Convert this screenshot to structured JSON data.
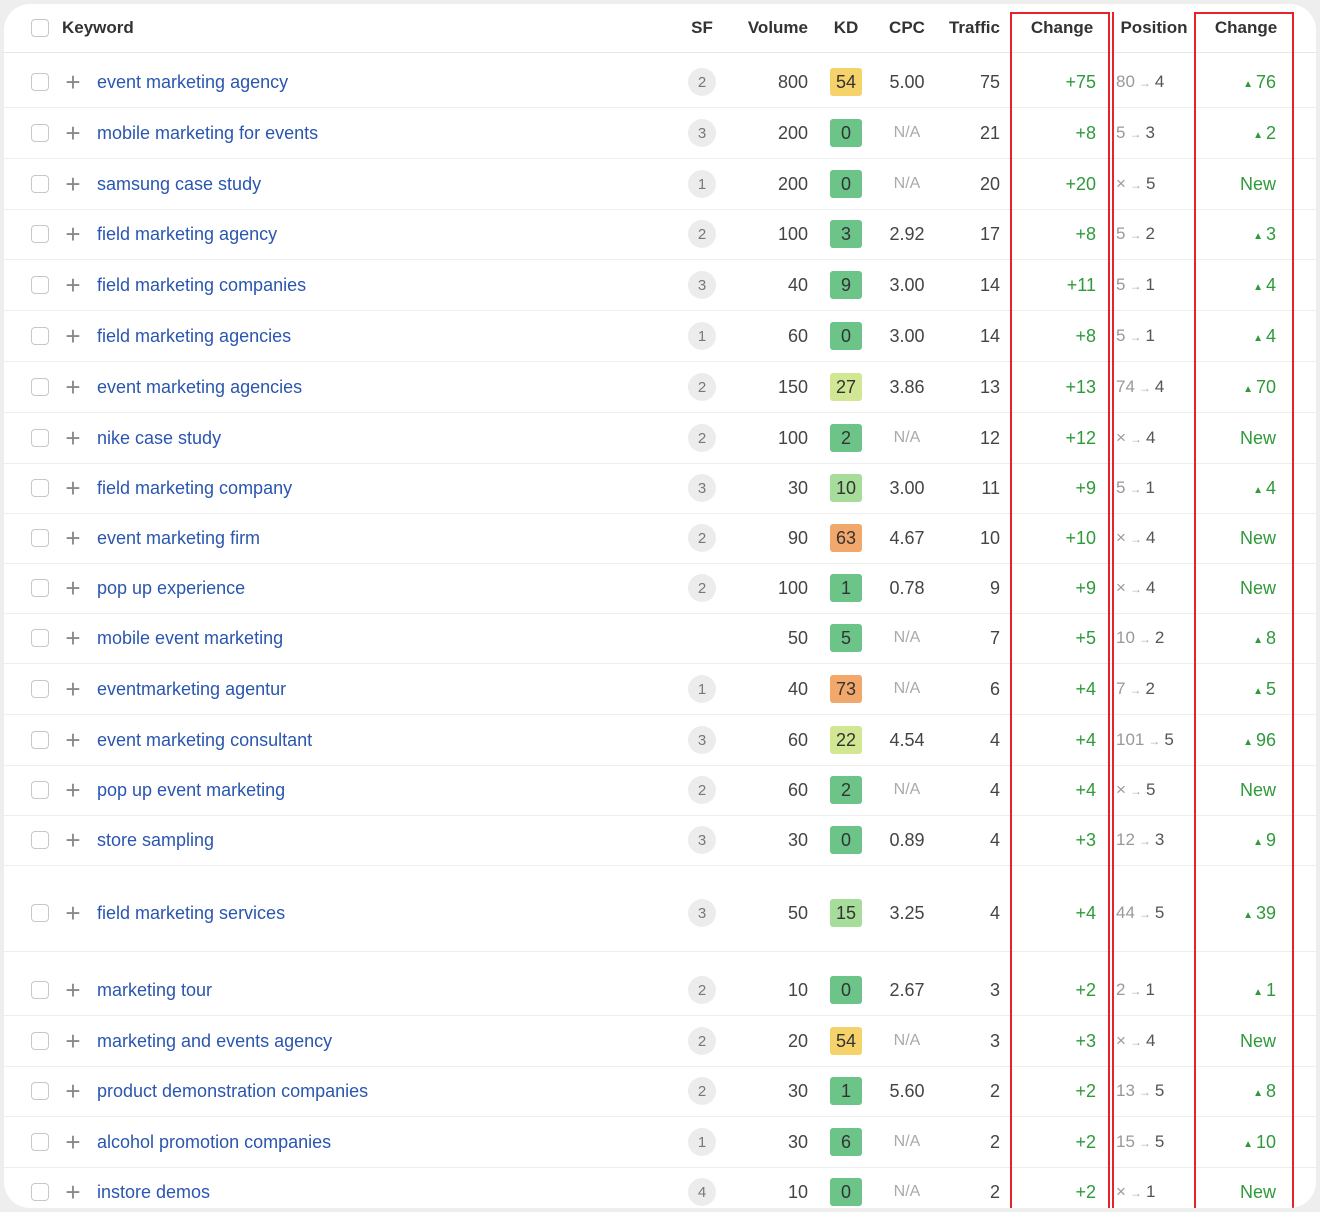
{
  "header": {
    "keyword": "Keyword",
    "sf": "SF",
    "volume": "Volume",
    "kd": "KD",
    "cpc": "CPC",
    "traffic": "Traffic",
    "traffic_change": "Change",
    "position": "Position",
    "position_change": "Change"
  },
  "colors": {
    "kd_green_dark": "#6cc488",
    "kd_green_light": "#a6dd9a",
    "kd_lime": "#d2e793",
    "kd_yellow": "#f6d36a",
    "kd_orange": "#f2a86a",
    "highlight_red": "#e8222a",
    "positive_green": "#2e9a3a",
    "keyword_blue": "#2a56b0"
  },
  "icons": {
    "add": "plus-icon",
    "checkbox": "checkbox-icon",
    "up": "triangle-up-icon",
    "arrow": "arrow-right-icon"
  },
  "arrow_glyph": "→",
  "up_glyph": "▲",
  "rows": [
    {
      "keyword": "event marketing agency",
      "sf": "2",
      "volume": "800",
      "kd": "54",
      "kd_color": "#f6d36a",
      "cpc": "5.00",
      "traffic": "75",
      "change": "+75",
      "pos_from": "80",
      "pos_to": "4",
      "pos_change": "76",
      "is_new": false
    },
    {
      "keyword": "mobile marketing for events",
      "sf": "3",
      "volume": "200",
      "kd": "0",
      "kd_color": "#6cc488",
      "cpc": "N/A",
      "traffic": "21",
      "change": "+8",
      "pos_from": "5",
      "pos_to": "3",
      "pos_change": "2",
      "is_new": false
    },
    {
      "keyword": "samsung case study",
      "sf": "1",
      "volume": "200",
      "kd": "0",
      "kd_color": "#6cc488",
      "cpc": "N/A",
      "traffic": "20",
      "change": "+20",
      "pos_from": "×",
      "pos_to": "5",
      "pos_change": "New",
      "is_new": true
    },
    {
      "keyword": "field marketing agency",
      "sf": "2",
      "volume": "100",
      "kd": "3",
      "kd_color": "#6cc488",
      "cpc": "2.92",
      "traffic": "17",
      "change": "+8",
      "pos_from": "5",
      "pos_to": "2",
      "pos_change": "3",
      "is_new": false
    },
    {
      "keyword": "field marketing companies",
      "sf": "3",
      "volume": "40",
      "kd": "9",
      "kd_color": "#6cc488",
      "cpc": "3.00",
      "traffic": "14",
      "change": "+11",
      "pos_from": "5",
      "pos_to": "1",
      "pos_change": "4",
      "is_new": false
    },
    {
      "keyword": "field marketing agencies",
      "sf": "1",
      "volume": "60",
      "kd": "0",
      "kd_color": "#6cc488",
      "cpc": "3.00",
      "traffic": "14",
      "change": "+8",
      "pos_from": "5",
      "pos_to": "1",
      "pos_change": "4",
      "is_new": false
    },
    {
      "keyword": "event marketing agencies",
      "sf": "2",
      "volume": "150",
      "kd": "27",
      "kd_color": "#d2e793",
      "cpc": "3.86",
      "traffic": "13",
      "change": "+13",
      "pos_from": "74",
      "pos_to": "4",
      "pos_change": "70",
      "is_new": false
    },
    {
      "keyword": "nike case study",
      "sf": "2",
      "volume": "100",
      "kd": "2",
      "kd_color": "#6cc488",
      "cpc": "N/A",
      "traffic": "12",
      "change": "+12",
      "pos_from": "×",
      "pos_to": "4",
      "pos_change": "New",
      "is_new": true
    },
    {
      "keyword": "field marketing company",
      "sf": "3",
      "volume": "30",
      "kd": "10",
      "kd_color": "#a6dd9a",
      "cpc": "3.00",
      "traffic": "11",
      "change": "+9",
      "pos_from": "5",
      "pos_to": "1",
      "pos_change": "4",
      "is_new": false
    },
    {
      "keyword": "event marketing firm",
      "sf": "2",
      "volume": "90",
      "kd": "63",
      "kd_color": "#f2a86a",
      "cpc": "4.67",
      "traffic": "10",
      "change": "+10",
      "pos_from": "×",
      "pos_to": "4",
      "pos_change": "New",
      "is_new": true
    },
    {
      "keyword": "pop up experience",
      "sf": "2",
      "volume": "100",
      "kd": "1",
      "kd_color": "#6cc488",
      "cpc": "0.78",
      "traffic": "9",
      "change": "+9",
      "pos_from": "×",
      "pos_to": "4",
      "pos_change": "New",
      "is_new": true
    },
    {
      "keyword": "mobile event marketing",
      "sf": "",
      "volume": "50",
      "kd": "5",
      "kd_color": "#6cc488",
      "cpc": "N/A",
      "traffic": "7",
      "change": "+5",
      "pos_from": "10",
      "pos_to": "2",
      "pos_change": "8",
      "is_new": false
    },
    {
      "keyword": "eventmarketing agentur",
      "sf": "1",
      "volume": "40",
      "kd": "73",
      "kd_color": "#f2a86a",
      "cpc": "N/A",
      "traffic": "6",
      "change": "+4",
      "pos_from": "7",
      "pos_to": "2",
      "pos_change": "5",
      "is_new": false
    },
    {
      "keyword": "event marketing consultant",
      "sf": "3",
      "volume": "60",
      "kd": "22",
      "kd_color": "#d2e793",
      "cpc": "4.54",
      "traffic": "4",
      "change": "+4",
      "pos_from": "101",
      "pos_to": "5",
      "pos_change": "96",
      "is_new": false
    },
    {
      "keyword": "pop up event marketing",
      "sf": "2",
      "volume": "60",
      "kd": "2",
      "kd_color": "#6cc488",
      "cpc": "N/A",
      "traffic": "4",
      "change": "+4",
      "pos_from": "×",
      "pos_to": "5",
      "pos_change": "New",
      "is_new": true
    },
    {
      "keyword": "store sampling",
      "sf": "3",
      "volume": "30",
      "kd": "0",
      "kd_color": "#6cc488",
      "cpc": "0.89",
      "traffic": "4",
      "change": "+3",
      "pos_from": "12",
      "pos_to": "3",
      "pos_change": "9",
      "is_new": false
    },
    {
      "keyword": "field marketing services",
      "sf": "3",
      "volume": "50",
      "kd": "15",
      "kd_color": "#a6dd9a",
      "cpc": "3.25",
      "traffic": "4",
      "change": "+4",
      "pos_from": "44",
      "pos_to": "5",
      "pos_change": "39",
      "is_new": false
    },
    {
      "keyword": "marketing tour",
      "sf": "2",
      "volume": "10",
      "kd": "0",
      "kd_color": "#6cc488",
      "cpc": "2.67",
      "traffic": "3",
      "change": "+2",
      "pos_from": "2",
      "pos_to": "1",
      "pos_change": "1",
      "is_new": false
    },
    {
      "keyword": "marketing and events agency",
      "sf": "2",
      "volume": "20",
      "kd": "54",
      "kd_color": "#f6d36a",
      "cpc": "N/A",
      "traffic": "3",
      "change": "+3",
      "pos_from": "×",
      "pos_to": "4",
      "pos_change": "New",
      "is_new": true
    },
    {
      "keyword": "product demonstration companies",
      "sf": "2",
      "volume": "30",
      "kd": "1",
      "kd_color": "#6cc488",
      "cpc": "5.60",
      "traffic": "2",
      "change": "+2",
      "pos_from": "13",
      "pos_to": "5",
      "pos_change": "8",
      "is_new": false
    },
    {
      "keyword": "alcohol promotion companies",
      "sf": "1",
      "volume": "30",
      "kd": "6",
      "kd_color": "#6cc488",
      "cpc": "N/A",
      "traffic": "2",
      "change": "+2",
      "pos_from": "15",
      "pos_to": "5",
      "pos_change": "10",
      "is_new": false
    },
    {
      "keyword": "instore demos",
      "sf": "4",
      "volume": "10",
      "kd": "0",
      "kd_color": "#6cc488",
      "cpc": "N/A",
      "traffic": "2",
      "change": "+2",
      "pos_from": "×",
      "pos_to": "1",
      "pos_change": "New",
      "is_new": true
    }
  ]
}
